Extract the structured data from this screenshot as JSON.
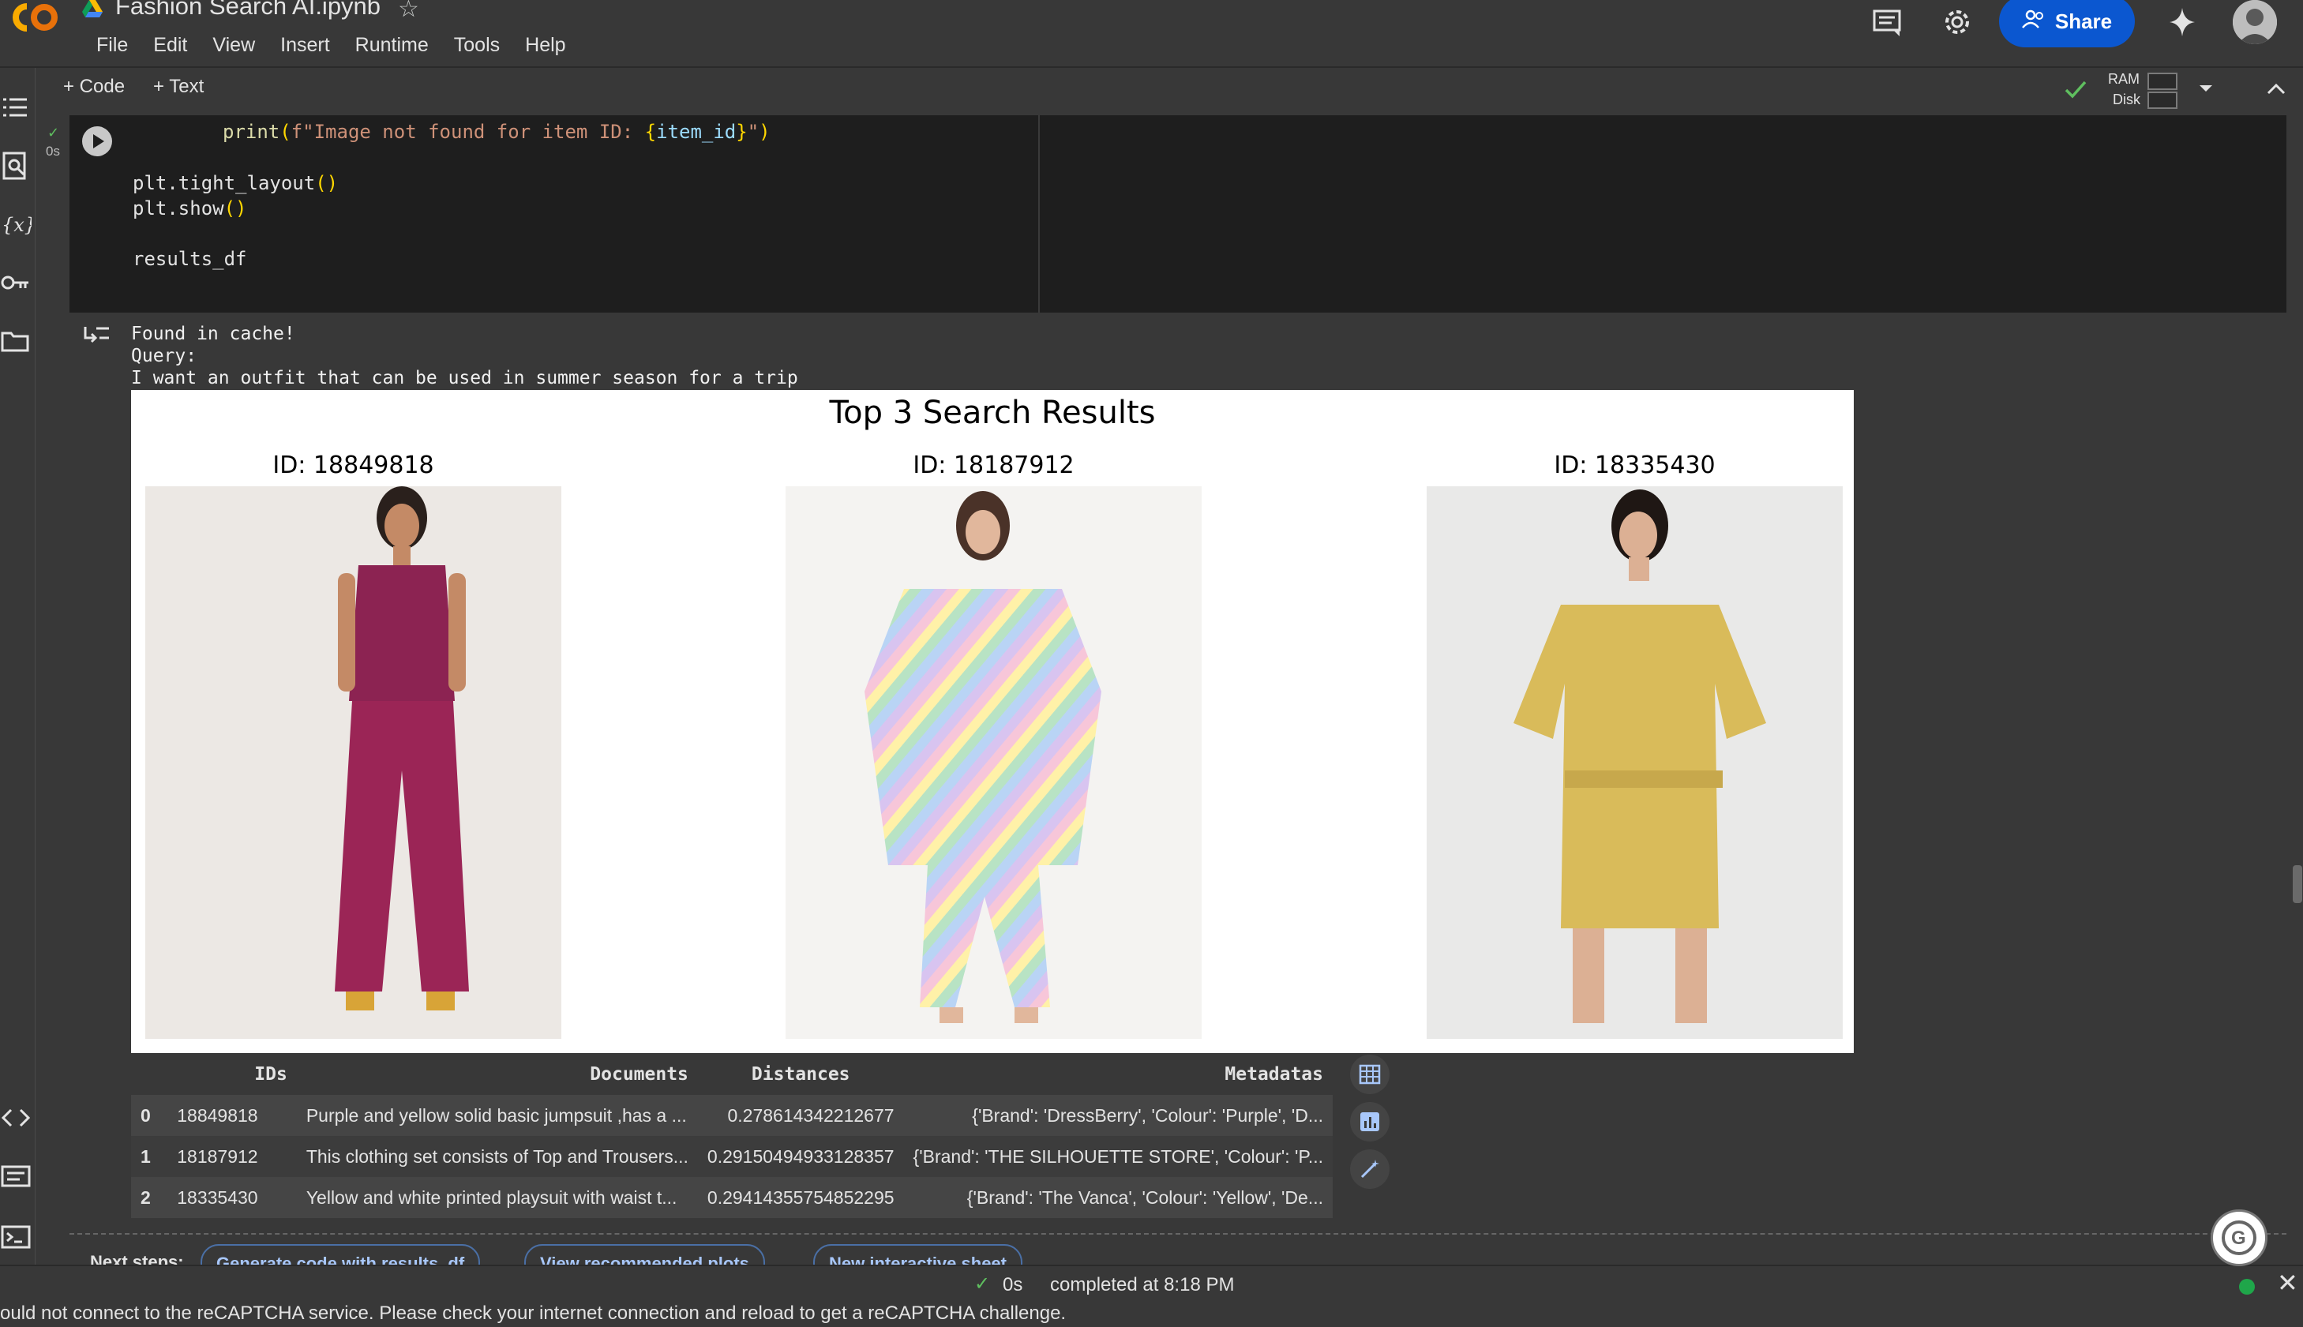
{
  "header": {
    "title": "Fashion Search AI.ipynb",
    "menus": [
      "File",
      "Edit",
      "View",
      "Insert",
      "Runtime",
      "Tools",
      "Help"
    ],
    "share_label": "Share"
  },
  "toolbar": {
    "add_code": "+ Code",
    "add_text": "+ Text",
    "ram_label": "RAM",
    "disk_label": "Disk"
  },
  "cell": {
    "exec_time": "0s",
    "code_lines": {
      "l1_fn": "print",
      "l1_open": "(",
      "l1_str": "f\"Image not found for item ID: ",
      "l1_brace_open": "{",
      "l1_var": "item_id",
      "l1_brace_close": "}",
      "l1_str_end": "\"",
      "l1_close": ")",
      "l2": "plt.tight_layout",
      "l2_paren": "()",
      "l3": "plt.show",
      "l3_paren": "()",
      "l4": "results_df"
    }
  },
  "output": {
    "line1": "Found in cache!",
    "line2": "Query:",
    "line3": "I want an outfit that can be used in summer season for a trip",
    "figure": {
      "title": "Top 3 Search Results",
      "items": [
        {
          "label": "ID: 18849818"
        },
        {
          "label": "ID: 18187912"
        },
        {
          "label": "ID: 18335430"
        }
      ]
    }
  },
  "table": {
    "headers": [
      "IDs",
      "Documents",
      "Distances",
      "Metadatas"
    ],
    "rows": [
      {
        "idx": "0",
        "id": "18849818",
        "doc": "Purple and yellow solid basic jumpsuit ,has a ...",
        "dist": "0.278614342212677",
        "meta": "{'Brand': 'DressBerry', 'Colour': 'Purple', 'D..."
      },
      {
        "idx": "1",
        "id": "18187912",
        "doc": "This clothing set consists of Top and Trousers...",
        "dist": "0.29150494933128357",
        "meta": "{'Brand': 'THE SILHOUETTE STORE', 'Colour': 'P..."
      },
      {
        "idx": "2",
        "id": "18335430",
        "doc": "Yellow and white printed playsuit with waist t...",
        "dist": "0.29414355754852295",
        "meta": "{'Brand': 'The Vanca', 'Colour': 'Yellow', 'De..."
      }
    ]
  },
  "next_steps": {
    "label": "Next steps:",
    "chips": [
      "Generate code with results_df",
      "View recommended plots",
      "New interactive sheet"
    ]
  },
  "status": {
    "time": "0s",
    "completed": "completed at 8:18 PM",
    "recaptcha": "ould not connect to the reCAPTCHA service. Please check your internet connection and reload to get a reCAPTCHA challenge."
  },
  "colors": {
    "background": "#383838",
    "code_bg": "#1e1e1e",
    "share_button": "#0b57d0",
    "status_ok": "#1fa64a"
  }
}
